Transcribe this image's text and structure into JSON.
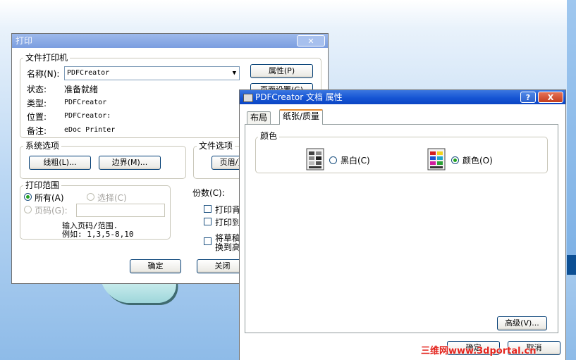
{
  "print_dialog": {
    "title": "打印",
    "printer_group": "文件打印机",
    "name_label": "名称(N):",
    "printer_name": "PDFCreator",
    "properties_button": "属性(P)",
    "page_setup_button": "页面设置(G)",
    "status_label": "状态:",
    "status_value": "准备就绪",
    "type_label": "类型:",
    "type_value": "PDFCreator",
    "location_label": "位置:",
    "location_value": "PDFCreator:",
    "comment_label": "备注:",
    "comment_value": "eDoc Printer",
    "system_options_group": "系统选项",
    "line_thickness_button": "线粗(L)...",
    "border_button": "边界(M)...",
    "file_options_group": "文件选项",
    "header_footer_button": "页眉/页",
    "print_range_group": "打印范围",
    "range_all": "所有(A)",
    "range_selection": "选择(C)",
    "range_pages": "页码(G):",
    "pages_value": "",
    "pages_hint_1": "输入页码/范围.",
    "pages_hint_2": "例如: 1,3,5-8,10",
    "copies_label": "份数(C):",
    "print_background_label": "打印背",
    "print_to_label": "打印到",
    "draft_label_1": "将草稿",
    "draft_label_2": "换到高",
    "ok_button": "确定",
    "close_button": "关闭"
  },
  "props_dialog": {
    "title": "PDFCreator 文档 属性",
    "help_button": "?",
    "close_button": "X",
    "tabs": [
      "布局",
      "纸张/质量"
    ],
    "selected_tab": "纸张/质量",
    "color_group": "颜色",
    "bw_option": "黑白(C)",
    "color_option": "颜色(O)",
    "selected_color_mode": "颜色(O)",
    "advanced_button": "高级(V)...",
    "ok_button": "确定",
    "cancel_button": "取消"
  },
  "watermark": "三维网www.3dportal.cn"
}
